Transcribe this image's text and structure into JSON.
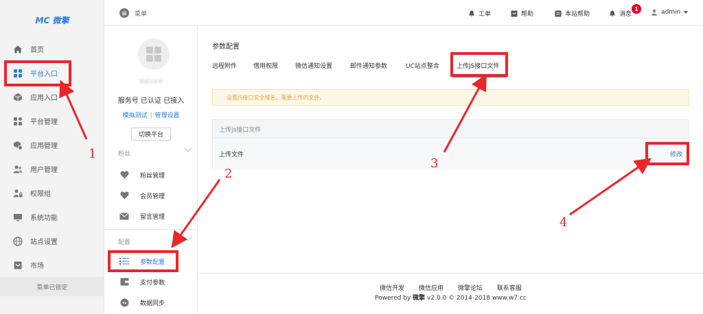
{
  "app": {
    "logo_text": "MC 微擎"
  },
  "sidebar": {
    "items": [
      {
        "label": "首页",
        "icon": "home-icon"
      },
      {
        "label": "平台入口",
        "icon": "grid-icon",
        "active": true
      },
      {
        "label": "应用入口",
        "icon": "cube-icon"
      },
      {
        "label": "平台管理",
        "icon": "apps-icon"
      },
      {
        "label": "应用管理",
        "icon": "gear-cube-icon"
      },
      {
        "label": "用户管理",
        "icon": "users-icon"
      },
      {
        "label": "权限组",
        "icon": "user-lock-icon"
      },
      {
        "label": "系统功能",
        "icon": "monitor-icon"
      },
      {
        "label": "站点设置",
        "icon": "globe-icon"
      },
      {
        "label": "市场",
        "icon": "store-icon"
      }
    ],
    "footer_label": "菜单已锁定"
  },
  "header": {
    "menu_label": "菜单",
    "links": [
      {
        "label": "工单",
        "icon": "bell-icon"
      },
      {
        "label": "帮助",
        "icon": "help-icon"
      },
      {
        "label": "本站帮助",
        "icon": "book-icon"
      },
      {
        "label": "消息",
        "icon": "bell-icon"
      }
    ],
    "message_badge": "1",
    "user_label": "admin"
  },
  "account": {
    "name": "测试公众号",
    "status": "服务号 已认证 已接入",
    "test_link": "模拟测试",
    "separator": "|",
    "manage_link": "管理设置",
    "switch_label": "切换平台"
  },
  "sub_sidebar": {
    "group_fans": {
      "title": "粉丝",
      "items": [
        {
          "label": "粉丝管理",
          "icon": "heart-icon"
        },
        {
          "label": "会员管理",
          "icon": "heart-icon"
        },
        {
          "label": "留言管理",
          "icon": "mail-icon"
        }
      ]
    },
    "group_config": {
      "title": "配置",
      "items": [
        {
          "label": "参数配置",
          "icon": "list-icon",
          "active": true
        },
        {
          "label": "支付参数",
          "icon": "wallet-icon"
        },
        {
          "label": "数据同步",
          "icon": "sync-icon"
        }
      ]
    }
  },
  "main": {
    "title": "参数配置",
    "tabs": [
      {
        "label": "远程附件"
      },
      {
        "label": "借用权限"
      },
      {
        "label": "微信通知设置"
      },
      {
        "label": "邮件通知参数"
      },
      {
        "label": "UC站点整合"
      },
      {
        "label": "上传JS接口文件",
        "active": true
      }
    ],
    "alert": "设置JS接口安全域名，需要上传的文件。",
    "panel_title": "上传js接口文件",
    "row_label": "上传文件",
    "row_action": "修改"
  },
  "footer": {
    "links": [
      "微信开发",
      "微信应用",
      "微擎论坛",
      "联系客服"
    ],
    "copyright_prefix": "Powered by ",
    "copyright_brand": "微擎",
    "copyright_suffix": " v2.0.0 © 2014-2018 www.w7.cc"
  },
  "annotations": {
    "step_1": "1",
    "step_2": "2",
    "step_3": "3",
    "step_4": "4",
    "color": "#e8262b"
  },
  "colors": {
    "accent": "#2a7de1",
    "alert_text": "#e8a33b",
    "badge": "#e6002b"
  }
}
